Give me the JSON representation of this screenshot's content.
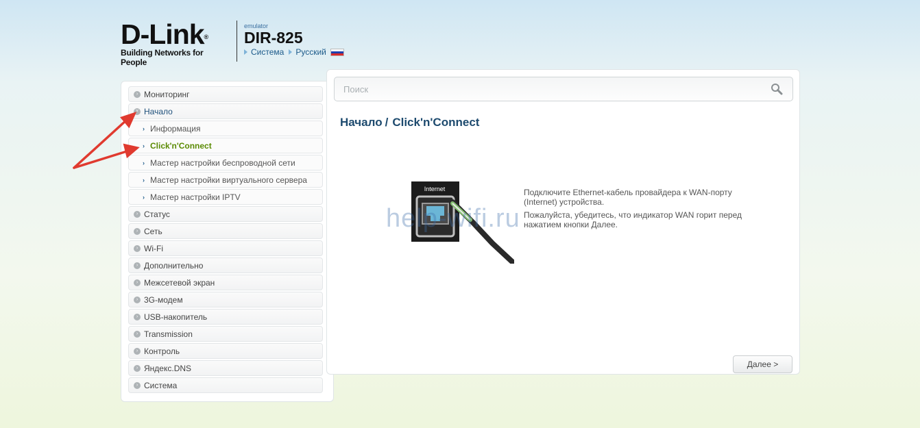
{
  "header": {
    "logo_text": "D-Link",
    "logo_reg": "®",
    "logo_tagline": "Building Networks for People",
    "emulator_label": "emulator",
    "model": "DIR-825",
    "link_system": "Система",
    "link_language": "Русский"
  },
  "sidebar": {
    "items": [
      {
        "label": "Мониторинг",
        "state": "collapsed"
      },
      {
        "label": "Начало",
        "state": "open"
      },
      {
        "label": "Статус"
      },
      {
        "label": "Сеть"
      },
      {
        "label": "Wi-Fi"
      },
      {
        "label": "Дополнительно"
      },
      {
        "label": "Межсетевой экран"
      },
      {
        "label": "3G-модем"
      },
      {
        "label": "USB-накопитель"
      },
      {
        "label": "Transmission"
      },
      {
        "label": "Контроль"
      },
      {
        "label": "Яндекс.DNS"
      },
      {
        "label": "Система"
      }
    ],
    "subitems": [
      {
        "label": "Информация"
      },
      {
        "label": "Click'n'Connect",
        "active": true
      },
      {
        "label": "Мастер настройки беспроводной сети"
      },
      {
        "label": "Мастер настройки виртуального сервера"
      },
      {
        "label": "Мастер настройки IPTV"
      }
    ]
  },
  "main": {
    "search_placeholder": "Поиск",
    "breadcrumb_parent": "Начало",
    "breadcrumb_sep": "/",
    "breadcrumb_current": "Click'n'Connect",
    "port_label": "Internet",
    "desc_1": "Подключите Ethernet-кабель провайдера к WAN-порту (Internet) устройства.",
    "desc_2": "Пожалуйста, убедитесь, что индикатор WAN горит перед нажатием кнопки Далее.",
    "next_button": "Далее >"
  },
  "watermark": "help-wifi.ru",
  "colors": {
    "title": "#1d4a6e",
    "active_item": "#5a8a00",
    "annotation_arrow": "#e03a2f"
  }
}
